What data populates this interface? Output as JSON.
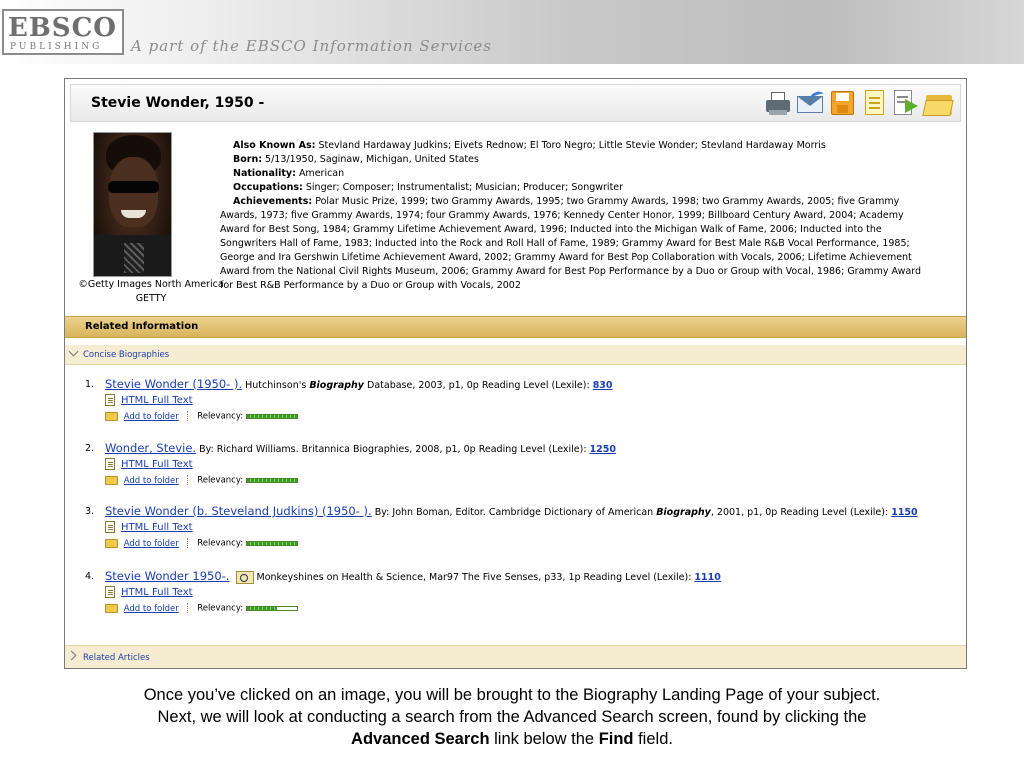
{
  "banner": {
    "logo_main": "EBSCO",
    "logo_sub": "PUBLISHING",
    "tagline": "A part of the EBSCO Information Services"
  },
  "record": {
    "title": "Stevie Wonder, 1950 -",
    "photo_credit_line1": "©Getty Images North America",
    "photo_credit_line2": "GETTY",
    "fields": {
      "aka_label": "Also Known As:",
      "aka_value": "Stevland Hardaway Judkins; Eivets Rednow; El Toro Negro; Little Stevie Wonder; Stevland Hardaway Morris",
      "born_label": "Born:",
      "born_value": "5/13/1950, Saginaw, Michigan, United States",
      "nationality_label": "Nationality:",
      "nationality_value": "American",
      "occupations_label": "Occupations:",
      "occupations_value": "Singer; Composer; Instrumentalist; Musician; Producer; Songwriter",
      "achievements_label": "Achievements:",
      "achievements_value": "Polar Music Prize, 1999; two Grammy Awards, 1995; two Grammy Awards, 1998; two Grammy Awards, 2005; five Grammy Awards, 1973; five Grammy Awards, 1974; four Grammy Awards, 1976; Kennedy Center Honor, 1999; Billboard Century Award, 2004; Academy Award for Best Song, 1984; Grammy Lifetime Achievement Award, 1996; Inducted into the Michigan Walk of Fame, 2006; Inducted into the Songwriters Hall of Fame, 1983; Inducted into the Rock and Roll Hall of Fame, 1989; Grammy Award for Best Male R&B Vocal Performance, 1985; George and Ira Gershwin Lifetime Achievement Award, 2002; Grammy Award for Best Pop Collaboration with Vocals, 2006; Lifetime Achievement Award from the National Civil Rights Museum, 2006; Grammy Award for Best Pop Performance by a Duo or Group with Vocal, 1986; Grammy Award for Best R&B Performance by a Duo or Group with Vocals, 2002"
    }
  },
  "toolbar_icons": [
    "printer-icon",
    "email-icon",
    "save-icon",
    "notes-icon",
    "export-icon",
    "folder-icon"
  ],
  "related": {
    "header": "Related Information",
    "concise": "Concise Biographies",
    "articles": "Related Articles"
  },
  "results": [
    {
      "num": "1.",
      "title": "Stevie Wonder (1950- ).",
      "src_pre": "Hutchinson's ",
      "src_em": "Biography",
      "src_post": " Database, 2003, p1, 0p Reading Level (Lexile): ",
      "lexile": "830",
      "fulltext": "HTML Full Text",
      "folder": "Add to folder",
      "relevancy_label": "Relevancy:",
      "relevancy": 1.0
    },
    {
      "num": "2.",
      "title": "Wonder, Stevie.",
      "src_pre": "By: Richard Williams. Britannica Biographies, 2008, p1, 0p Reading Level (Lexile): ",
      "src_em": "",
      "src_post": "",
      "lexile": "1250",
      "fulltext": "HTML Full Text",
      "folder": "Add to folder",
      "relevancy_label": "Relevancy:",
      "relevancy": 1.0
    },
    {
      "num": "3.",
      "title": "Stevie Wonder (b. Steveland Judkins) (1950- ).",
      "src_pre": "By: John Boman, Editor. Cambridge Dictionary of American ",
      "src_em": "Biography",
      "src_post": ", 2001, p1, 0p Reading Level (Lexile): ",
      "lexile": "1150",
      "fulltext": "HTML Full Text",
      "folder": "Add to folder",
      "relevancy_label": "Relevancy:",
      "relevancy": 1.0
    },
    {
      "num": "4.",
      "title": "Stevie Wonder 1950-.",
      "src_pre": "Monkeyshines on Health & Science, Mar97 The Five Senses, p33, 1p Reading Level (Lexile): ",
      "src_em": "",
      "src_post": "",
      "lexile": "1110",
      "fulltext": "HTML Full Text",
      "folder": "Add to folder",
      "relevancy_label": "Relevancy:",
      "relevancy": 0.6
    }
  ],
  "caption": {
    "line1": "Once you’ve clicked on an image, you will be brought to the Biography Landing Page of your subject.",
    "line2": "Next, we will look at conducting a search from the Advanced Search screen, found by clicking the",
    "bold1": "Advanced Search",
    "mid": " link below the ",
    "bold2": "Find",
    "end": " field."
  }
}
